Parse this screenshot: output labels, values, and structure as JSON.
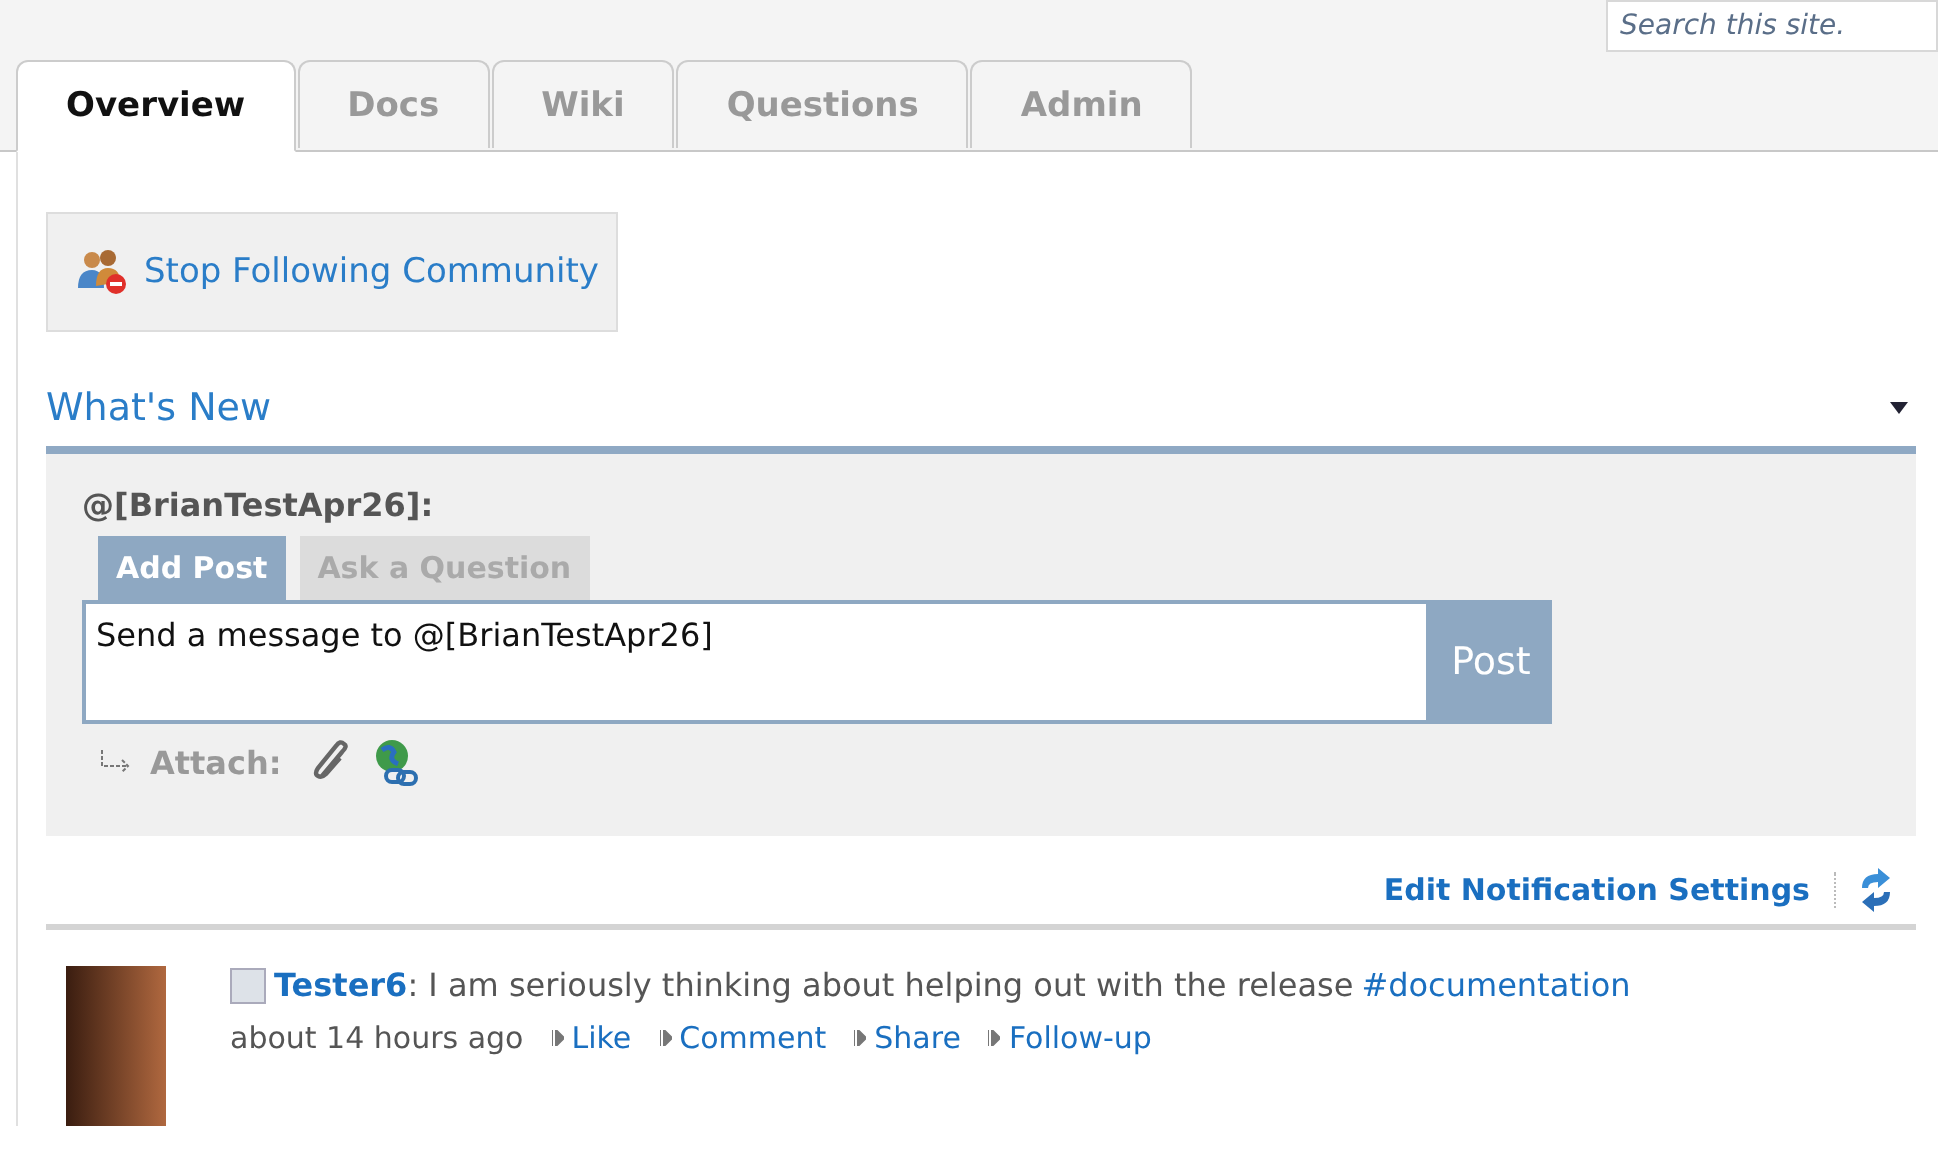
{
  "search": {
    "placeholder": "Search this site."
  },
  "tabs": [
    {
      "label": "Overview",
      "selected": true
    },
    {
      "label": "Docs",
      "selected": false
    },
    {
      "label": "Wiki",
      "selected": false
    },
    {
      "label": "Questions",
      "selected": false
    },
    {
      "label": "Admin",
      "selected": false
    }
  ],
  "follow_button": {
    "label": "Stop Following Community"
  },
  "section_title": "What's New",
  "composer": {
    "recipient": "@[BrianTestApr26]:",
    "tabs": [
      {
        "label": "Add Post",
        "selected": true
      },
      {
        "label": "Ask a Question",
        "selected": false
      }
    ],
    "value": "Send a message to @[BrianTestApr26]",
    "post_button": "Post",
    "attach_label": "Attach:"
  },
  "notification_link": "Edit Notification Settings",
  "posts": [
    {
      "author": "Tester6",
      "separator": ":",
      "text": "I am seriously thinking about helping out with the release",
      "tag": "#documentation",
      "time": "about 14 hours ago",
      "actions": [
        "Like",
        "Comment",
        "Share",
        "Follow-up"
      ]
    }
  ]
}
